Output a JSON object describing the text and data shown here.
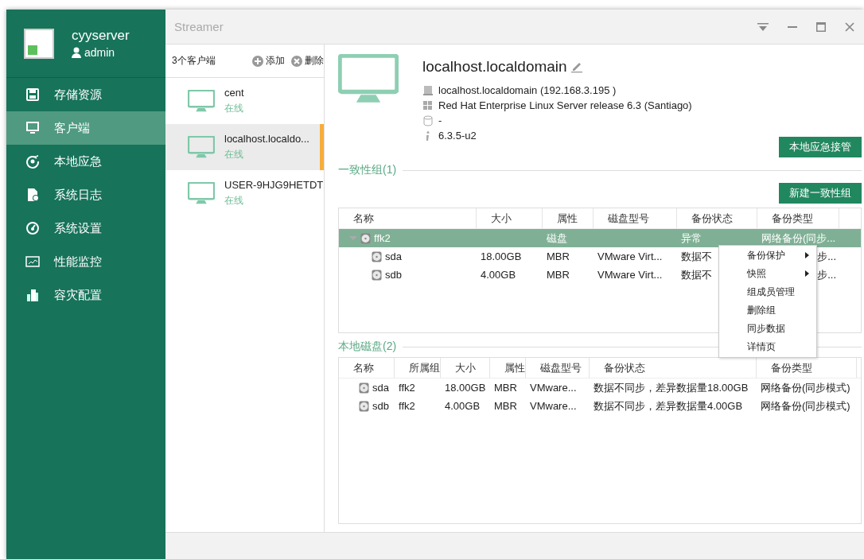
{
  "window": {
    "title": "Streamer"
  },
  "sidebar": {
    "server_name": "cyyserver",
    "user": "admin",
    "items": [
      {
        "label": "存储资源",
        "selected": false
      },
      {
        "label": "客户端",
        "selected": true
      },
      {
        "label": "本地应急",
        "selected": false
      },
      {
        "label": "系统日志",
        "selected": false
      },
      {
        "label": "系统设置",
        "selected": false
      },
      {
        "label": "性能监控",
        "selected": false
      },
      {
        "label": "容灾配置",
        "selected": false
      }
    ]
  },
  "clients": {
    "count_label": "3个客户端",
    "actions": [
      {
        "label": "添加",
        "kind": "add"
      },
      {
        "label": "删除",
        "kind": "remove"
      }
    ],
    "items": [
      {
        "name": "cent",
        "status": "在线",
        "selected": false
      },
      {
        "name": "localhost.localdo...",
        "status": "在线",
        "selected": true
      },
      {
        "name": "USER-9HJG9HETDT",
        "status": "在线",
        "selected": false
      }
    ]
  },
  "detail": {
    "title": "localhost.localdomain",
    "info": [
      {
        "kind": "host",
        "text": "localhost.localdomain (192.168.3.195 )"
      },
      {
        "kind": "os",
        "text": "Red Hat Enterprise Linux Server release 6.3 (Santiago)"
      },
      {
        "kind": "storage",
        "text": "-"
      },
      {
        "kind": "version",
        "text": "6.3.5-u2"
      }
    ],
    "takeover_button": "本地应急接管"
  },
  "consistency_groups": {
    "heading": "一致性组(1)",
    "new_button": "新建一致性组",
    "columns": [
      "名称",
      "大小",
      "属性",
      "磁盘型号",
      "备份状态",
      "备份类型"
    ],
    "rows": [
      {
        "name": "ffk2",
        "attribute": "磁盘",
        "backup_status": "异常",
        "backup_type": "网络备份(同步...",
        "selected": true,
        "expanded": true,
        "children": [
          {
            "name": "sda",
            "size": "18.00GB",
            "attribute": "MBR",
            "disk_model": "VMware Virt...",
            "backup_status": "数据不",
            "backup_type": "步...",
            "selected": false
          },
          {
            "name": "sdb",
            "size": "4.00GB",
            "attribute": "MBR",
            "disk_model": "VMware Virt...",
            "backup_status": "数据不",
            "backup_type": "步...",
            "selected": false
          }
        ]
      }
    ]
  },
  "context_menu": {
    "items": [
      {
        "label": "备份保护",
        "submenu": true
      },
      {
        "label": "快照",
        "submenu": true
      },
      {
        "label": "组成员管理",
        "submenu": false
      },
      {
        "label": "删除组",
        "submenu": false
      },
      {
        "label": "同步数据",
        "submenu": false
      },
      {
        "label": "详情页",
        "submenu": false
      }
    ]
  },
  "local_disks": {
    "heading": "本地磁盘(2)",
    "columns": [
      "名称",
      "所属组",
      "大小",
      "属性",
      "磁盘型号",
      "备份状态",
      "备份类型"
    ],
    "rows": [
      {
        "name": "sda",
        "group": "ffk2",
        "size": "18.00GB",
        "attribute": "MBR",
        "disk_model": "VMware...",
        "backup_status": "数据不同步，差异数据量18.00GB",
        "backup_type": "网络备份(同步模式)",
        "selected": false
      },
      {
        "name": "sdb",
        "group": "ffk2",
        "size": "4.00GB",
        "attribute": "MBR",
        "disk_model": "VMware...",
        "backup_status": "数据不同步，差异数据量4.00GB",
        "backup_type": "网络备份(同步模式)",
        "selected": false
      }
    ]
  }
}
